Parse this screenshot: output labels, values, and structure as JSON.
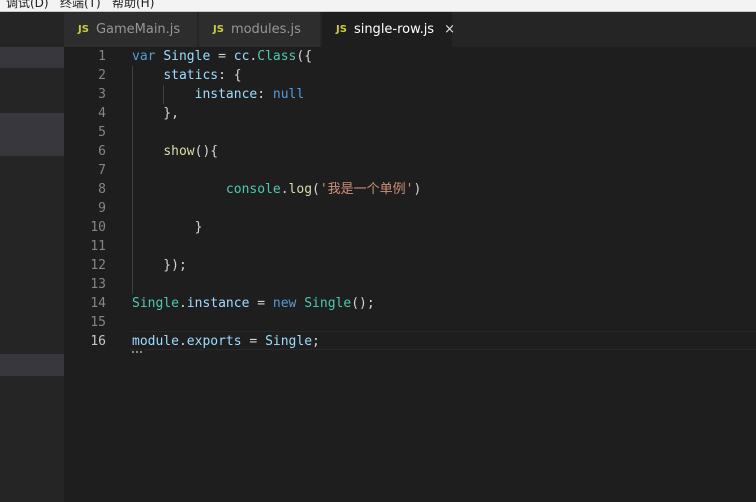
{
  "menubar": {
    "items": [
      "调试(D)",
      "终端(T)",
      "帮助(H)"
    ]
  },
  "tabs": [
    {
      "badge": "JS",
      "label": "GameMain.js",
      "active": false
    },
    {
      "badge": "JS",
      "label": "modules.js",
      "active": false
    },
    {
      "badge": "JS",
      "label": "single-row.js",
      "active": true,
      "close": "×"
    }
  ],
  "editor": {
    "current_line": 16,
    "line_numbers": [
      "1",
      "2",
      "3",
      "4",
      "5",
      "6",
      "7",
      "8",
      "9",
      "10",
      "11",
      "12",
      "13",
      "14",
      "15",
      "16"
    ]
  },
  "code": {
    "l1": {
      "t1": "var",
      "t2": " ",
      "t3": "Single",
      "t4": " = ",
      "t5": "cc",
      "t6": ".",
      "t7": "Class",
      "t8": "({"
    },
    "l2": {
      "t1": "    ",
      "t2": "statics",
      "t3": ": {"
    },
    "l3": {
      "t1": "        ",
      "t2": "instance",
      "t3": ": ",
      "t4": "null"
    },
    "l4": {
      "t1": "    },"
    },
    "l6": {
      "t1": "    ",
      "t2": "show",
      "t3": "(){"
    },
    "l8": {
      "t1": "            ",
      "t2": "console",
      "t3": ".",
      "t4": "log",
      "t5": "(",
      "t6": "'我是一个单例'",
      "t7": ")"
    },
    "l10": {
      "t1": "        }"
    },
    "l12": {
      "t1": "    });"
    },
    "l14": {
      "t1": "Single",
      "t2": ".",
      "t3": "instance",
      "t4": " = ",
      "t5": "new",
      "t6": " ",
      "t7": "Single",
      "t8": "();"
    },
    "l16": {
      "t1": "module",
      "t2": ".",
      "t3": "exports",
      "t4": " = ",
      "t5": "Single",
      "t6": ";"
    }
  }
}
